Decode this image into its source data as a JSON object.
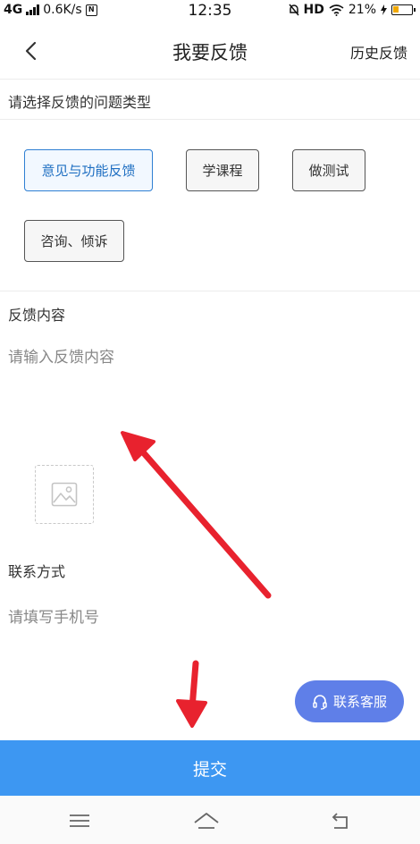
{
  "status_bar": {
    "network": "4G",
    "speed": "0.6K/s",
    "time": "12:35",
    "hd": "HD",
    "battery_percent": "21%",
    "battery_level": 0.21
  },
  "header": {
    "title": "我要反馈",
    "history_label": "历史反馈"
  },
  "feedback_type": {
    "label": "请选择反馈的问题类型",
    "options": [
      {
        "label": "意见与功能反馈",
        "selected": true
      },
      {
        "label": "学课程",
        "selected": false
      },
      {
        "label": "做测试",
        "selected": false
      },
      {
        "label": "咨询、倾诉",
        "selected": false
      }
    ]
  },
  "content": {
    "label": "反馈内容",
    "placeholder": "请输入反馈内容"
  },
  "contact": {
    "label": "联系方式",
    "placeholder": "请填写手机号"
  },
  "service_button": {
    "label": "联系客服"
  },
  "submit_button": {
    "label": "提交"
  },
  "colors": {
    "accent": "#3d97f2",
    "service": "#5f7fe8",
    "selected_border": "#2f7fd3",
    "annotation_arrow": "#e8222e"
  },
  "icons": {
    "back": "chevron-left-icon",
    "image_upload": "image-icon",
    "headset": "headset-icon",
    "nav_menu": "menu-icon",
    "nav_home": "home-icon",
    "nav_back": "back-icon"
  }
}
